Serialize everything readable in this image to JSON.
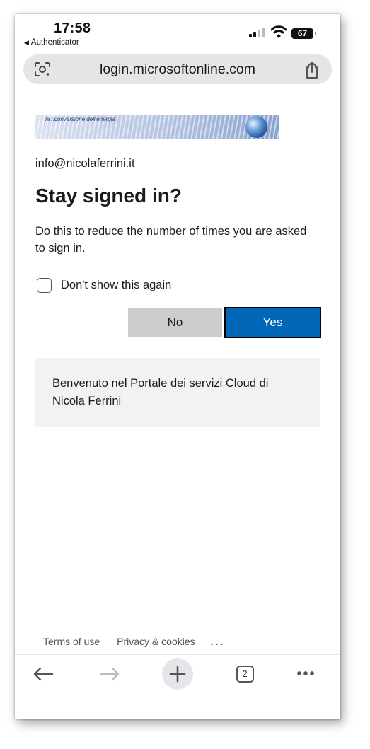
{
  "status_bar": {
    "time": "17:58",
    "back_app": "Authenticator",
    "battery": "67"
  },
  "address_bar": {
    "url": "login.microsoftonline.com",
    "left_icon": "google-lens-icon",
    "right_icon": "share-icon"
  },
  "banner": {
    "tagline": "la riconversione dell'energia"
  },
  "signin": {
    "email": "info@nicolaferrini.it",
    "title": "Stay signed in?",
    "description": "Do this to reduce the number of times you are asked to sign in.",
    "checkbox_label": "Don't show this again",
    "checkbox_checked": false,
    "no_label": "No",
    "yes_label": "Yes"
  },
  "info": {
    "text": "Benvenuto nel Portale dei servizi Cloud di Nicola Ferrini"
  },
  "footer": {
    "terms": "Terms of use",
    "privacy": "Privacy & cookies",
    "more": "..."
  },
  "toolbar": {
    "tab_count": "2",
    "more": "•••"
  },
  "colors": {
    "accent": "#0067b8",
    "no_button": "#cccccc",
    "info_box": "#f2f2f2"
  }
}
